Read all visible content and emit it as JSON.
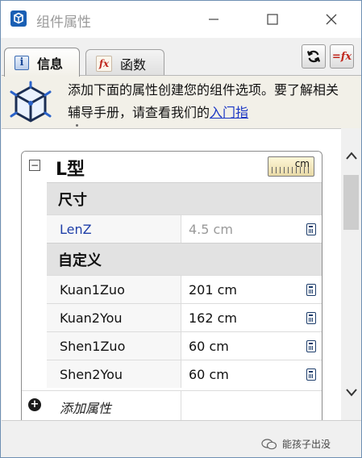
{
  "window": {
    "title": "组件属性",
    "controls": {
      "minimize": "minimize",
      "maximize": "maximize",
      "close": "close"
    }
  },
  "tabs": [
    {
      "label": "信息",
      "icon": "info-icon",
      "active": true
    },
    {
      "label": "函数",
      "icon": "fx-icon",
      "active": false
    }
  ],
  "toolbar": {
    "refresh_icon": "refresh-icon",
    "formula_glyph": "=fx"
  },
  "banner": {
    "text": "添加下面的属性创建您的组件选项。要了解相关辅导手册，请查看我们的",
    "link": "入门指"
  },
  "panel": {
    "collapse_glyph": "−",
    "title": "L型",
    "unit": "cm",
    "sections": [
      {
        "title": "尺寸",
        "rows": [
          {
            "name": "LenZ",
            "value": "4.5 cm"
          }
        ]
      },
      {
        "title": "自定义",
        "rows": [
          {
            "name": "Kuan1Zuo",
            "value": "201 cm"
          },
          {
            "name": "Kuan2You",
            "value": "162 cm"
          },
          {
            "name": "Shen1Zuo",
            "value": "60 cm"
          },
          {
            "name": "Shen2You",
            "value": "60 cm"
          }
        ]
      }
    ],
    "add_glyph": "+",
    "add_label": "添加属性"
  },
  "watermark": {
    "text": "能孩子出没"
  },
  "colors": {
    "link": "#1a36c4",
    "accent_blue": "#1f3fa8",
    "border": "#6e8fb3"
  }
}
